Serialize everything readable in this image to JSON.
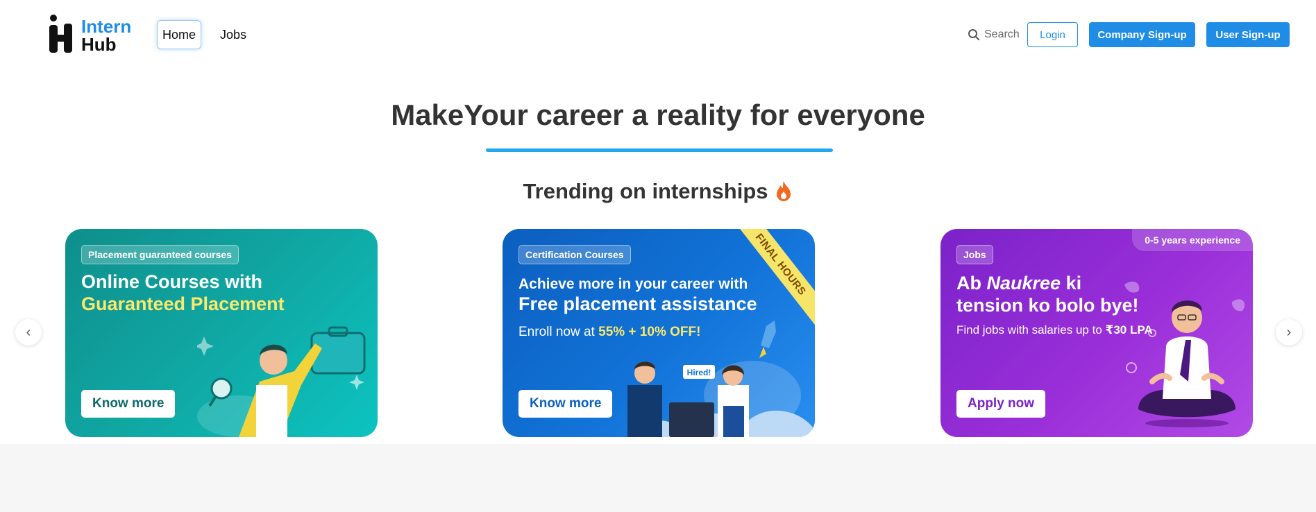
{
  "brand": {
    "line1": "Intern",
    "line2": "Hub"
  },
  "nav": {
    "home": "Home",
    "jobs": "Jobs"
  },
  "header_actions": {
    "search_label": "Search",
    "login": "Login",
    "company_signup": "Company Sign-up",
    "user_signup": "User Sign-up"
  },
  "hero": {
    "title": "MakeYour career a reality for everyone",
    "trending": "Trending on internships"
  },
  "carousel": {
    "prev_glyph": "‹",
    "next_glyph": "›",
    "cards": [
      {
        "tag": "Placement guaranteed courses",
        "headline_1": "Online Courses with",
        "headline_2": "Guaranteed Placement",
        "cta": "Know more"
      },
      {
        "tag": "Certification Courses",
        "headline_1": "Achieve more in your career with",
        "headline_2": "Free placement assistance",
        "sub_prefix": "Enroll now at ",
        "sub_highlight": "55% + 10% OFF!",
        "ribbon": "FINAL HOURS",
        "badge": "Hired!",
        "cta": "Know more"
      },
      {
        "tag": "Jobs",
        "badge": "0-5 years experience",
        "headline_1a": "Ab ",
        "headline_1b": "Naukree",
        "headline_1c": " ki",
        "headline_2": "tension ko bolo bye!",
        "sub_prefix": "Find jobs with salaries up to ",
        "sub_highlight": "₹30 LPA",
        "cta": "Apply now"
      }
    ]
  },
  "colors": {
    "brand_blue": "#1f8ce6",
    "underline": "#22a7f0",
    "card1": "#10a7a3",
    "card2": "#1273d8",
    "card3": "#9a2fd9",
    "highlight_yellow": "#fbe96b"
  },
  "icons": [
    "search-icon",
    "fire-icon",
    "chevron-left-icon",
    "chevron-right-icon"
  ]
}
